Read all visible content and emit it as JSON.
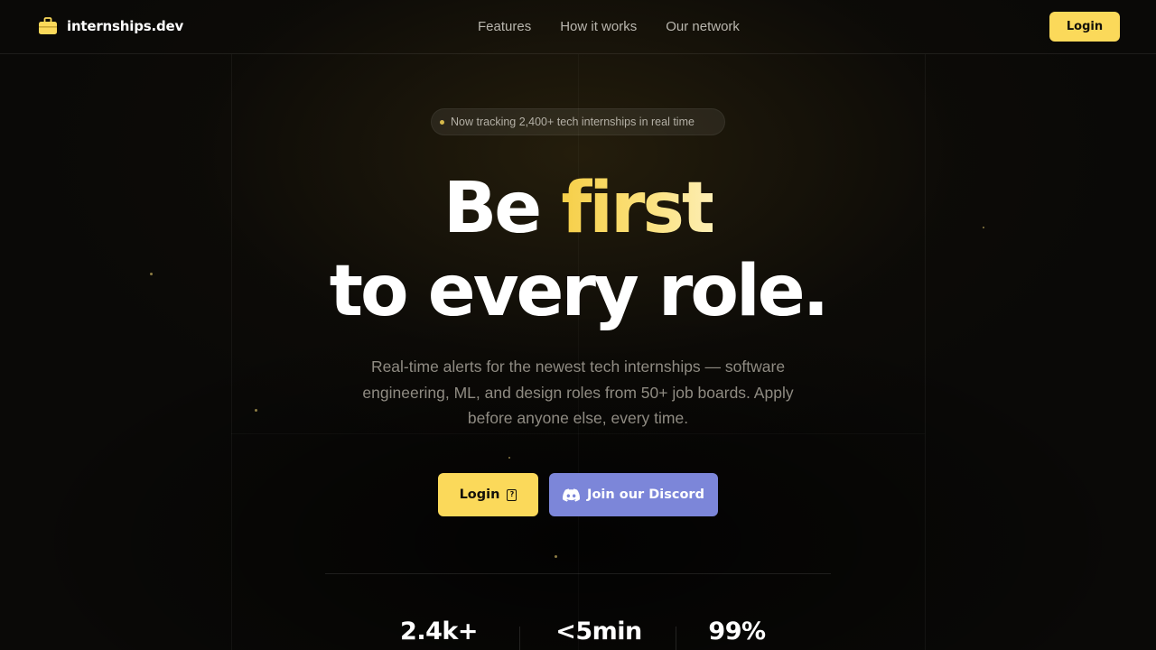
{
  "brand": {
    "name": "internships.dev",
    "icon": "briefcase-icon",
    "accent_color": "#fbd95a"
  },
  "nav": {
    "links": [
      {
        "label": "Features"
      },
      {
        "label": "How it works"
      },
      {
        "label": "Our network"
      }
    ],
    "login_label": "Login"
  },
  "hero": {
    "badge_text": "Now tracking 2,400+ tech internships in real time",
    "headline_start": "Be ",
    "headline_accent": "first",
    "headline_line2": "to every role.",
    "subtext": "Real-time alerts for the newest tech internships — software engineering, ML, and design roles from 50+ job boards. Apply before anyone else, every time.",
    "primary_cta": {
      "label": "Login",
      "icon": "login-icon"
    },
    "secondary_cta": {
      "label": "Join our Discord",
      "icon": "discord-icon",
      "color": "#7c86d9"
    }
  },
  "stats": [
    {
      "value": "2.4k+"
    },
    {
      "value": "<5min"
    },
    {
      "value": "99%"
    }
  ]
}
